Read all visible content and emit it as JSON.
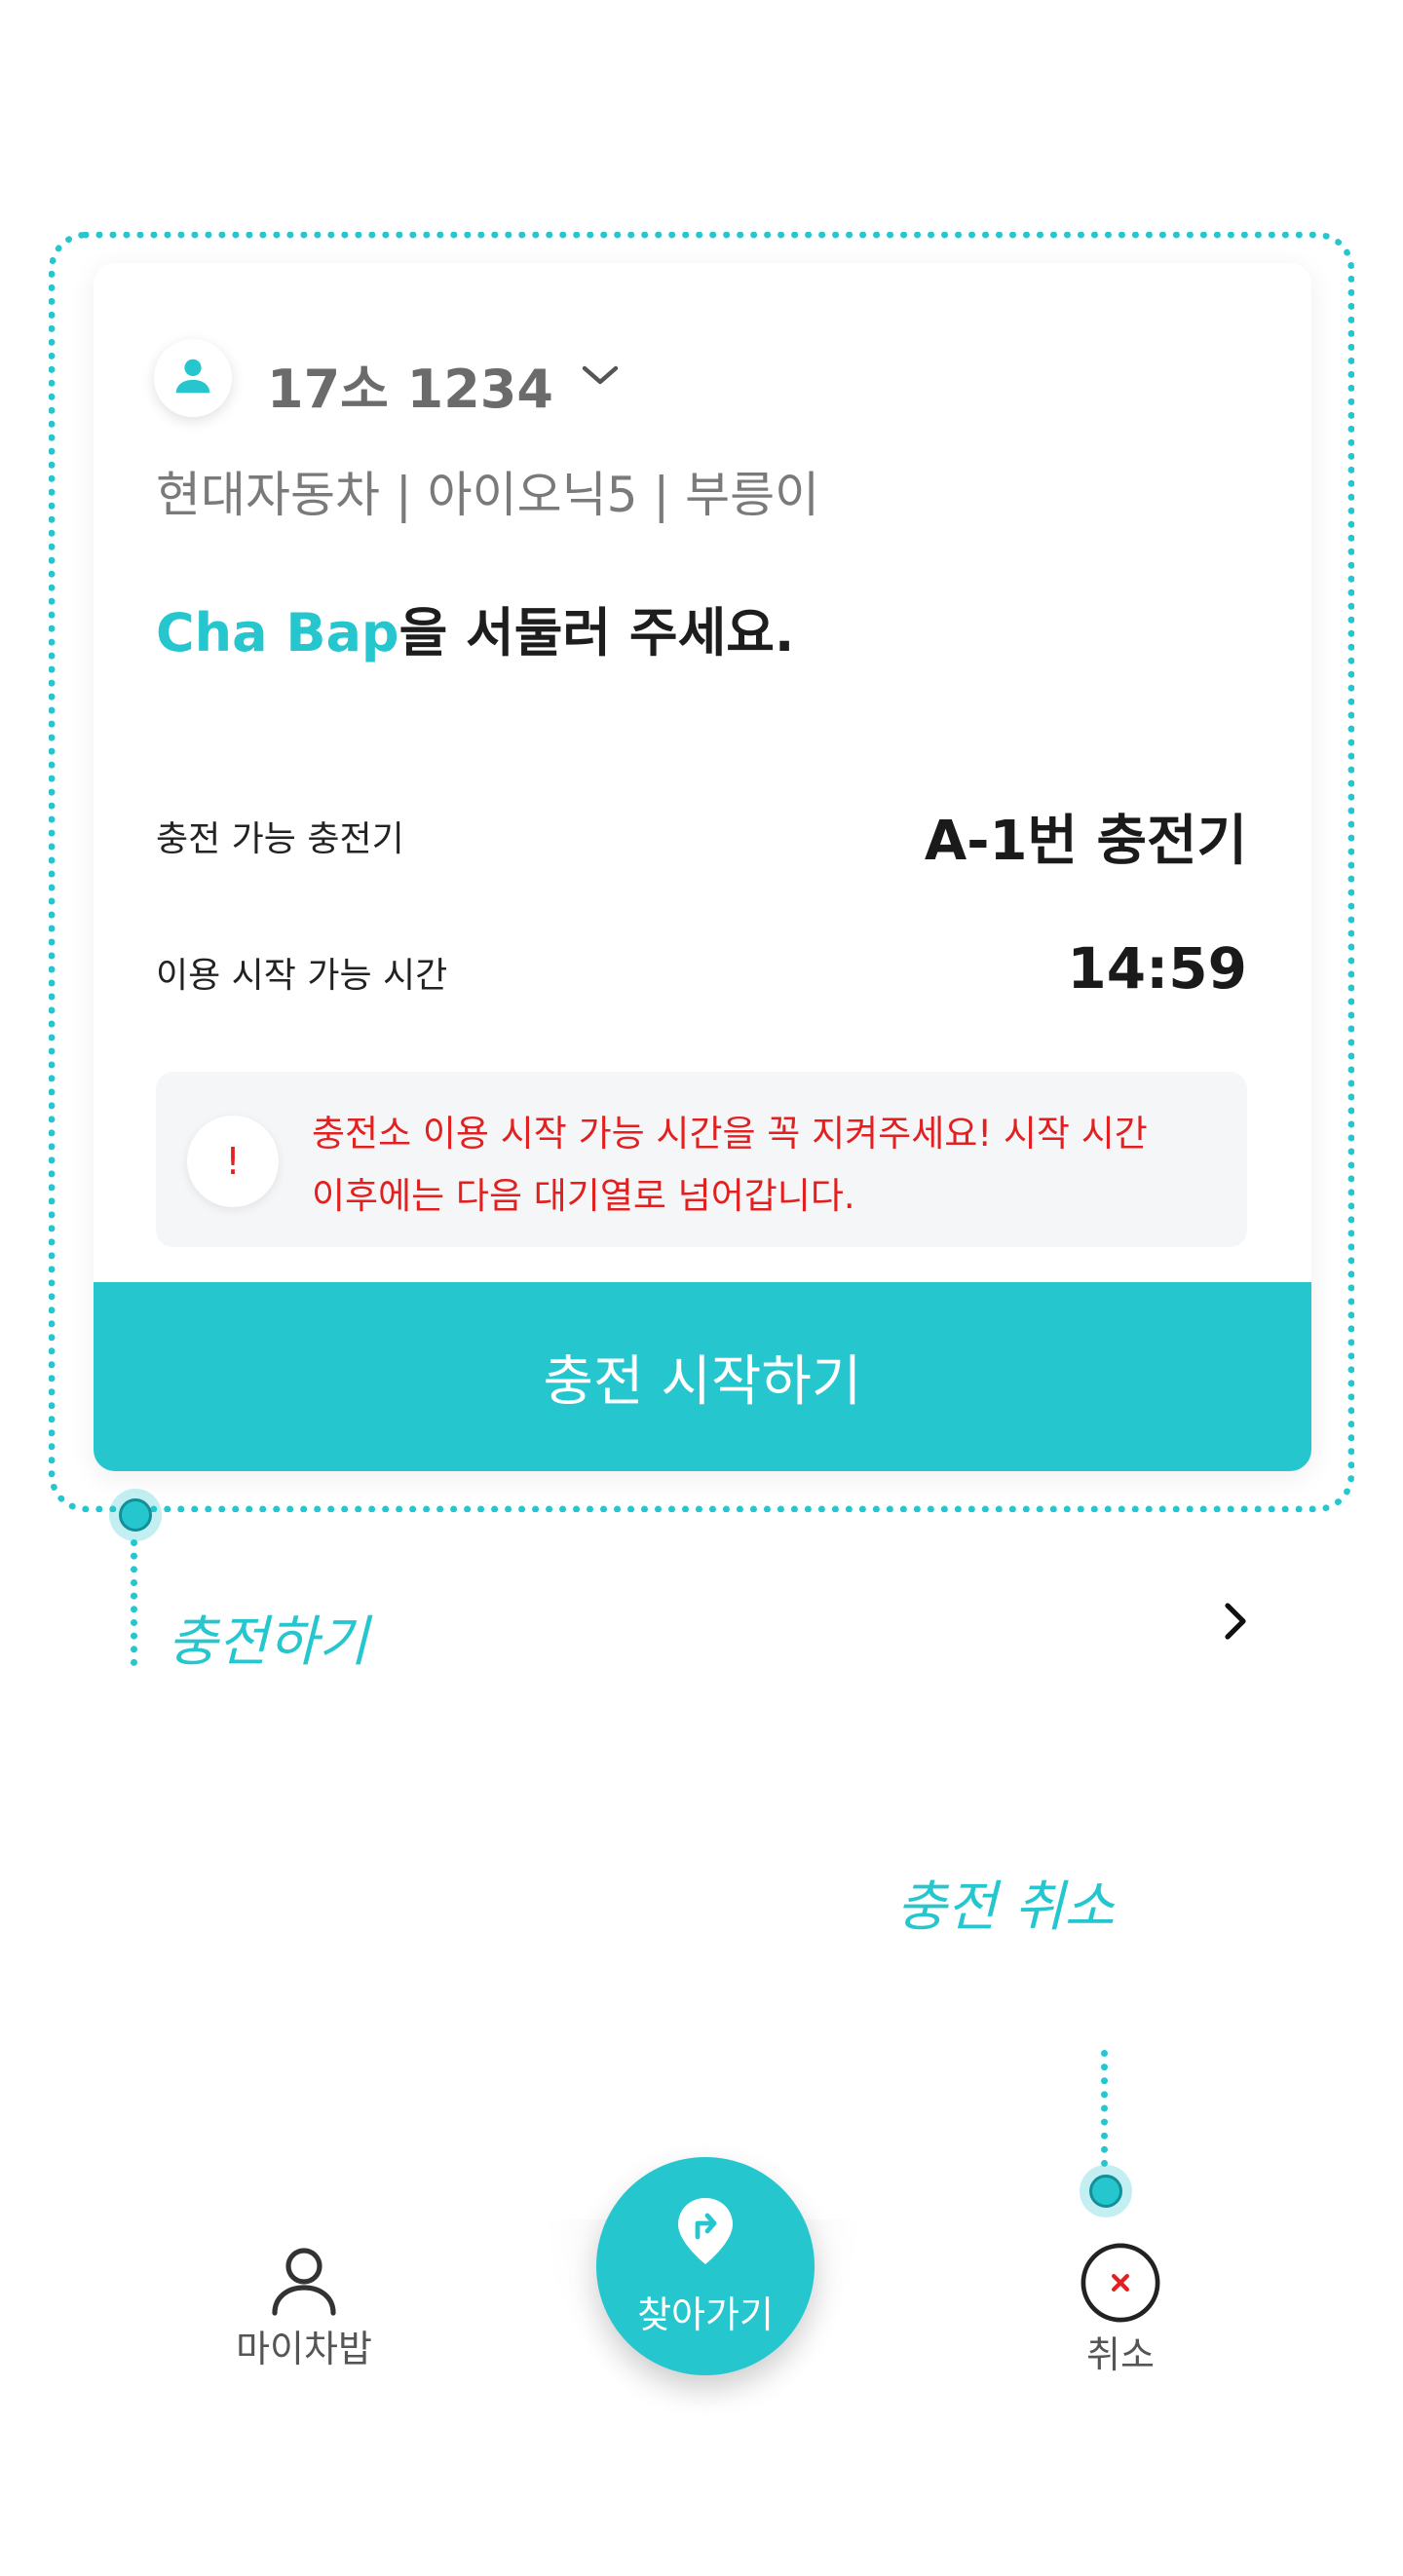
{
  "card": {
    "plate": "17소 1234",
    "vehicle": "현대자동차 | 아이오닉5 | 부릉이",
    "headline_brand": "Cha Bap",
    "headline_rest": "을 서둘러 주세요.",
    "charger_label": "충전 가능 충전기",
    "charger_value": "A-1번 충전기",
    "time_label": "이용 시작 가능 시간",
    "time_value": "14:59",
    "warning_icon": "!",
    "warning_line1": "충전소 이용 시작 가능 시간을 꼭 지켜주세요! 시작 시간",
    "warning_line2": "이후에는 다음 대기열로 넘어갑니다.",
    "start_button": "충전 시작하기"
  },
  "annotations": {
    "charge": "충전하기",
    "cancel": "충전 취소"
  },
  "bottom_nav": {
    "my_label": "마이차밥",
    "find_label": "찾아가기",
    "cancel_label": "취소"
  },
  "colors": {
    "accent": "#26c6cf",
    "warning": "#e32020"
  },
  "icons": {
    "avatar": "person-icon",
    "dropdown": "chevron-down-icon",
    "next": "chevron-right-icon",
    "my": "user-outline-icon",
    "find": "location-pin-turn-icon",
    "cancel": "close-circle-icon"
  }
}
